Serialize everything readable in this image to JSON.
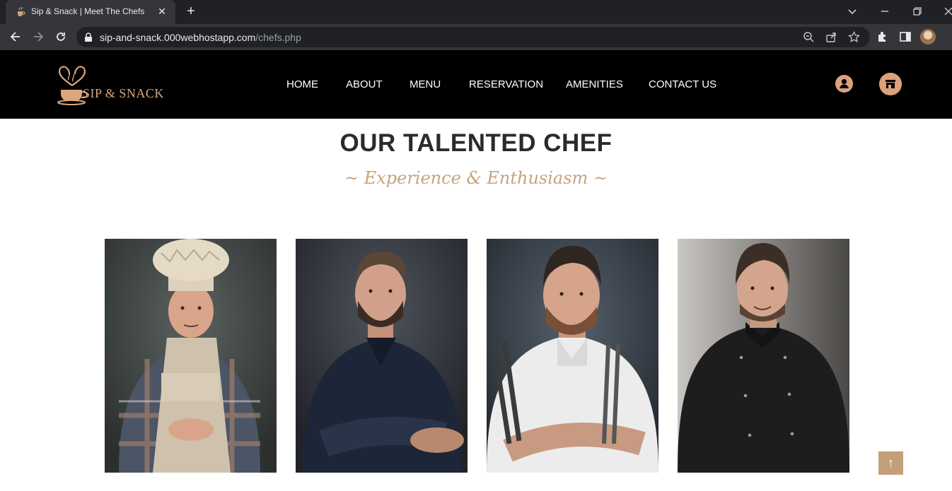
{
  "browser": {
    "tab_title": "Sip & Snack | Meet The Chefs",
    "url_host": "sip-and-snack.000webhostapp.com",
    "url_path": "/chefs.php",
    "new_tab_label": "+",
    "close_tab_label": "✕"
  },
  "site": {
    "logo_text": "SIP & SNACK",
    "nav": [
      "HOME",
      "ABOUT",
      "MENU",
      "RESERVATION",
      "AMENITIES",
      "CONTACT US"
    ],
    "icons": [
      "user-icon",
      "store-icon"
    ],
    "accent_color": "#d9a27c"
  },
  "main": {
    "title": "OUR TALENTED CHEF",
    "subtitle": "~ Experience & Enthusiasm ~",
    "chefs": [
      {
        "image": "chef-portrait-hat-apron"
      },
      {
        "image": "chef-portrait-navy-shirt"
      },
      {
        "image": "chef-portrait-white-coat-tongs"
      },
      {
        "image": "chef-portrait-black-coat"
      }
    ]
  },
  "back_to_top_label": "↑"
}
